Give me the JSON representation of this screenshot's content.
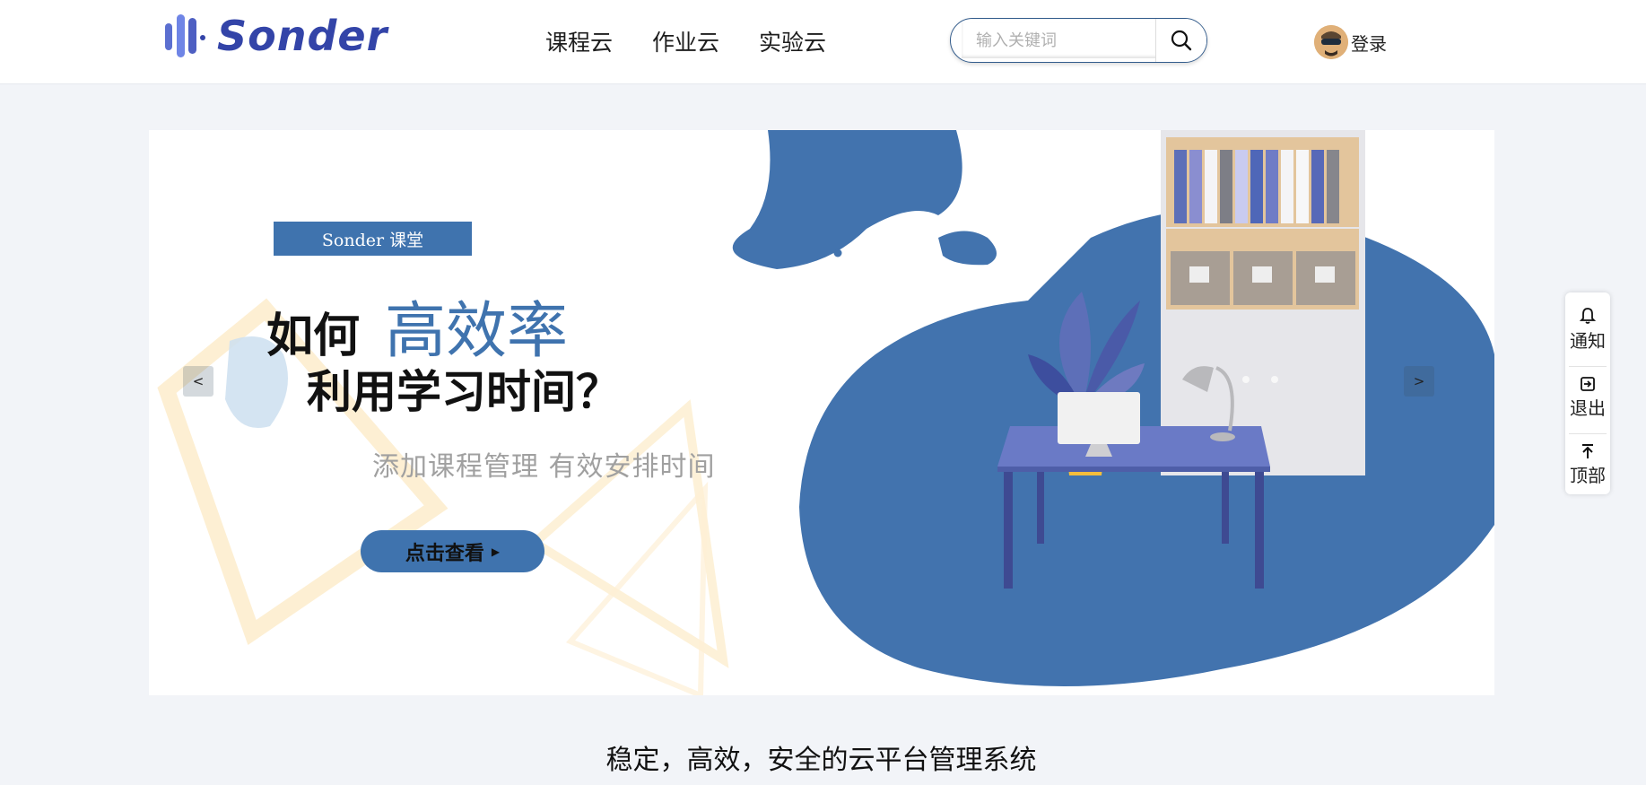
{
  "brand": {
    "logo_text": "Sonder",
    "color": "#3344a8"
  },
  "nav": {
    "items": [
      "课程云",
      "作业云",
      "实验云"
    ]
  },
  "search": {
    "placeholder": "输入关键词",
    "icon": "search-icon"
  },
  "user": {
    "login_label": "登录",
    "avatar_icon": "avatar"
  },
  "banner": {
    "tag": "Sonder 课堂",
    "headline_prefix": "如何",
    "headline_highlight": "高效率",
    "headline_line2": "利用学习时间？",
    "subtitle": "添加课程管理 有效安排时间",
    "cta_label": "点击查看",
    "prev_label": "<",
    "next_label": ">",
    "accent_color": "#3f73ae"
  },
  "floatbar": {
    "items": [
      {
        "label": "通知",
        "icon": "bell-icon"
      },
      {
        "label": "退出",
        "icon": "logout-icon"
      },
      {
        "label": "顶部",
        "icon": "to-top-icon"
      }
    ]
  },
  "slogan": "稳定，高效，安全的云平台管理系统"
}
